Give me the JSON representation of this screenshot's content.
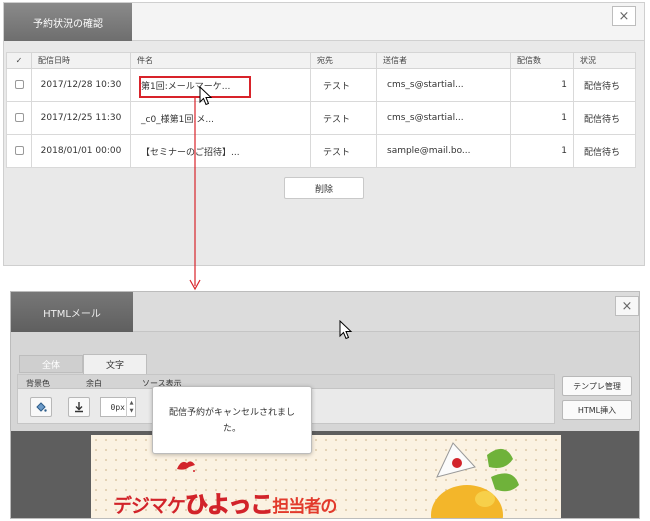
{
  "top_dialog": {
    "title": "予約状況の確認",
    "close_label": "×",
    "table": {
      "headers": [
        "✓",
        "配信日時",
        "件名",
        "宛先",
        "送信者",
        "配信数",
        "状況"
      ],
      "rows": [
        {
          "date": "2017/12/28 10:30",
          "subject": "第1回:メールマーケ...",
          "destination": "テスト",
          "sender": "cms_s@startial...",
          "count": "1",
          "status": "配信待ち"
        },
        {
          "date": "2017/12/25 11:30",
          "subject": "_c0_様第1回:メ...",
          "destination": "テスト",
          "sender": "cms_s@startial...",
          "count": "1",
          "status": "配信待ち"
        },
        {
          "date": "2018/01/01 00:00",
          "subject": "【セミナーのご招待】...",
          "destination": "テスト",
          "sender": "sample@mail.bo...",
          "count": "1",
          "status": "配信待ち"
        }
      ]
    },
    "delete_label": "削除"
  },
  "bottom_window": {
    "title": "HTMLメール",
    "close_label": "×",
    "tabs": [
      "全体",
      "文字"
    ],
    "toolbar": {
      "labels": [
        "背景色",
        "余白",
        "ソース表示"
      ],
      "margin_value": "0px",
      "spinner_up": "▲",
      "spinner_down": "▼",
      "template_label": "テンプレ管理",
      "html_insert_label": "HTML挿入"
    },
    "banner": {
      "text_a": "デジマケ",
      "text_b": "ひよっこ",
      "text_c": "担当者の"
    },
    "toast_message": "配信予約がキャンセルされました。"
  },
  "colors": {
    "highlight": "#d8232a",
    "arrow": "#d8232a",
    "banner_text": "#d2232a"
  },
  "icons": [
    "close-icon",
    "paint-bucket-icon",
    "download-icon",
    "mouse-cursor-icon",
    "arrow-down-icon"
  ]
}
